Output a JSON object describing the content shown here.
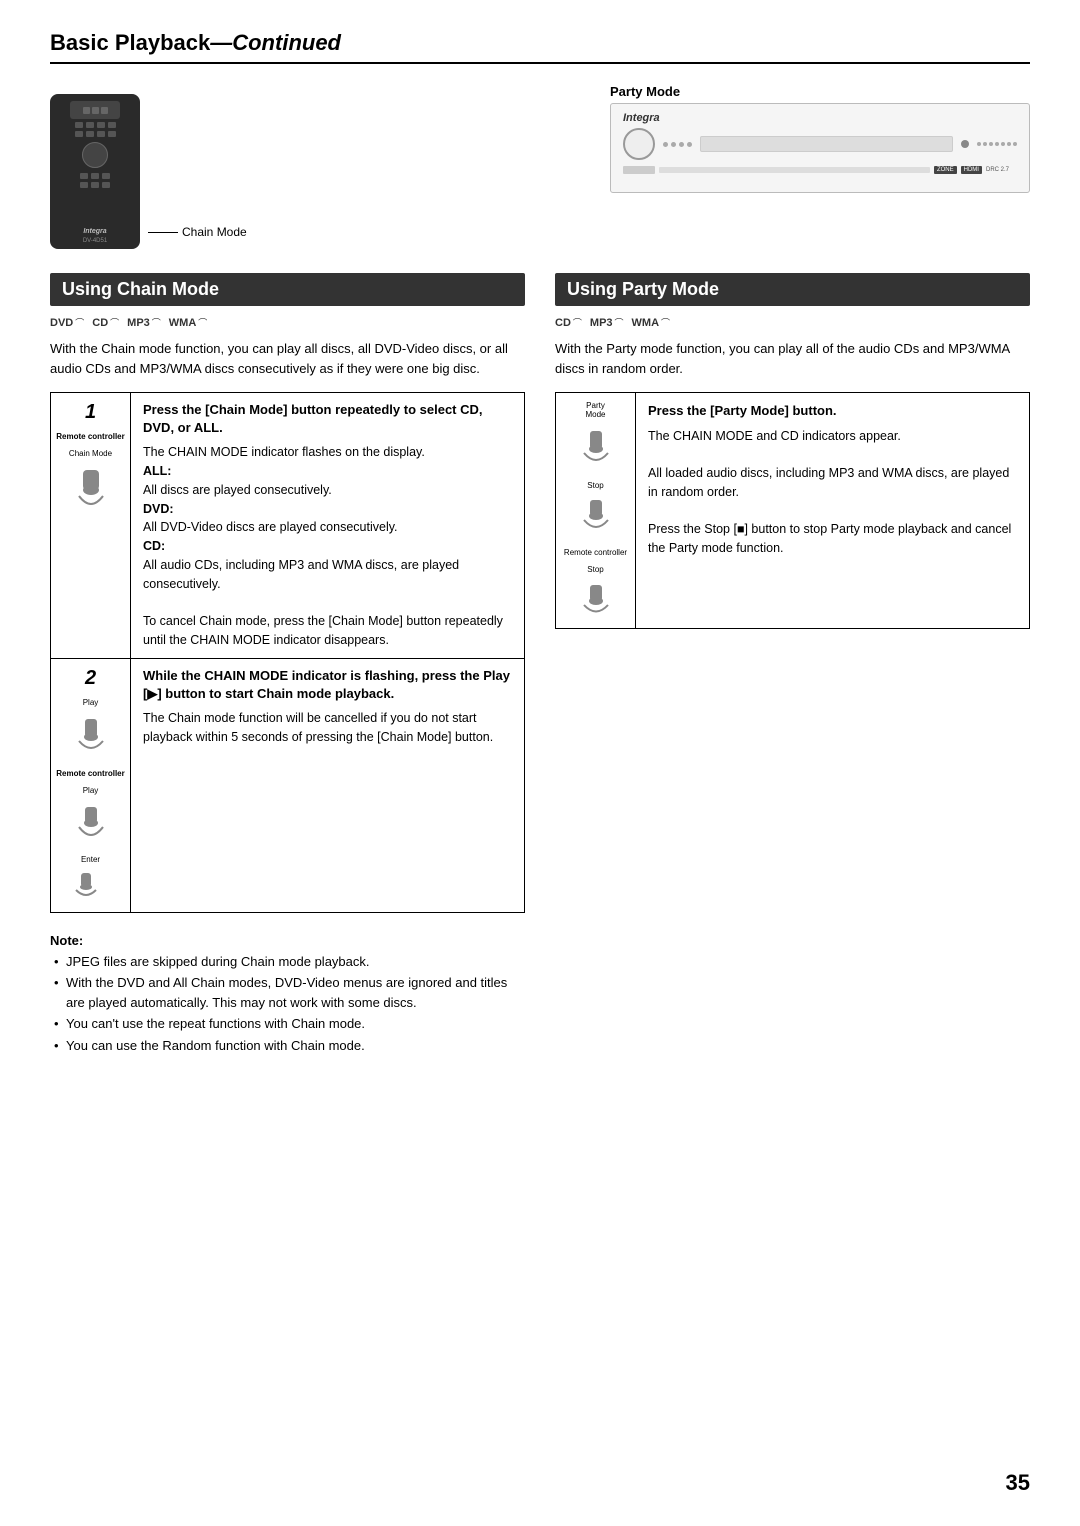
{
  "header": {
    "title": "Basic Playback",
    "subtitle": "Continued"
  },
  "diagrams": {
    "chain_mode_label": "Chain Mode",
    "party_mode_label": "Party Mode"
  },
  "chain_mode_section": {
    "heading": "Using Chain Mode",
    "formats": [
      "DVD",
      "CD",
      "MP3",
      "WMA"
    ],
    "description": "With the Chain mode function, you can play all discs, all DVD-Video discs, or all audio CDs and MP3/WMA discs consecutively as if they were one big disc.",
    "steps": [
      {
        "number": "1",
        "controller_label": "Remote controller",
        "button_label": "Chain Mode",
        "title": "Press the [Chain Mode] button repeatedly to select CD, DVD, or ALL.",
        "body_parts": [
          {
            "type": "text",
            "text": "The CHAIN MODE indicator flashes on the display."
          },
          {
            "type": "bold",
            "text": "ALL:"
          },
          {
            "type": "text",
            "text": "All discs are played consecutively."
          },
          {
            "type": "bold",
            "text": "DVD:"
          },
          {
            "type": "text",
            "text": "All DVD-Video discs are played consecutively."
          },
          {
            "type": "bold",
            "text": "CD:"
          },
          {
            "type": "text",
            "text": "All audio CDs, including MP3 and WMA discs, are played consecutively."
          },
          {
            "type": "text",
            "text": "To cancel Chain mode, press the [Chain Mode] button repeatedly until the CHAIN MODE indicator disappears."
          }
        ]
      },
      {
        "number": "2",
        "controller_label": "Remote controller",
        "button_label": "Play",
        "title": "While the CHAIN MODE indicator is flashing, press the Play [▶] button to start Chain mode playback.",
        "body_parts": [
          {
            "type": "text",
            "text": "The Chain mode function will be cancelled if you do not start playback within 5 seconds of pressing the [Chain Mode] button."
          }
        ]
      }
    ]
  },
  "party_mode_section": {
    "heading": "Using Party Mode",
    "formats": [
      "CD",
      "MP3",
      "WMA"
    ],
    "description": "With the Party mode function, you can play all of the audio CDs and MP3/WMA discs in random order.",
    "step": {
      "controller_label": "Remote controller",
      "button_labels": [
        "Party Mode",
        "Stop"
      ],
      "title": "Press the [Party Mode] button.",
      "body_parts": [
        {
          "type": "text",
          "text": "The CHAIN MODE and CD indicators appear."
        },
        {
          "type": "text",
          "text": "All loaded audio discs, including MP3 and WMA discs, are played in random order."
        },
        {
          "type": "text",
          "text": "Press the Stop [■] button to stop Party mode playback and cancel the Party mode function."
        }
      ]
    }
  },
  "notes": {
    "title": "Note:",
    "items": [
      "JPEG files are skipped during Chain mode playback.",
      "With the DVD and All Chain modes, DVD-Video menus are ignored and titles are played automatically. This may not work with some discs.",
      "You can't use the repeat functions with Chain mode.",
      "You can use the Random function with Chain mode."
    ]
  },
  "page_number": "35"
}
